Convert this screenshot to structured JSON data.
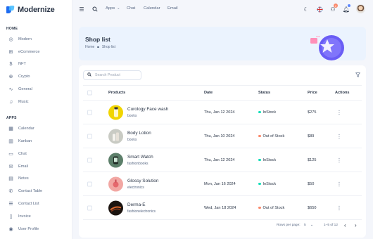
{
  "app": {
    "name": "Modernize"
  },
  "colors": {
    "primary": "#5d87ff",
    "success": "#13deb9",
    "warning": "#fa896b",
    "text": "#2a3547",
    "muted": "#5a6a85"
  },
  "sidebar": {
    "sections": [
      {
        "title": "HOME",
        "items": [
          {
            "label": "Modern",
            "icon": "aperture-icon"
          },
          {
            "label": "eCommerce",
            "icon": "shopping-cart-icon"
          },
          {
            "label": "NFT",
            "icon": "currency-dollar-icon"
          },
          {
            "label": "Crypto",
            "icon": "cpu-icon"
          },
          {
            "label": "General",
            "icon": "activity-icon"
          },
          {
            "label": "Music",
            "icon": "music-icon"
          }
        ]
      },
      {
        "title": "APPS",
        "items": [
          {
            "label": "Calendar",
            "icon": "calendar-icon"
          },
          {
            "label": "Kanban",
            "icon": "layout-kanban-icon"
          },
          {
            "label": "Chat",
            "icon": "message-icon"
          },
          {
            "label": "Email",
            "icon": "mail-icon"
          },
          {
            "label": "Notes",
            "icon": "notes-icon"
          },
          {
            "label": "Contact Table",
            "icon": "phone-icon"
          },
          {
            "label": "Contact List",
            "icon": "list-details-icon"
          },
          {
            "label": "Invoice",
            "icon": "file-text-icon"
          },
          {
            "label": "User Profile",
            "icon": "user-circle-icon"
          }
        ]
      }
    ]
  },
  "topbar": {
    "apps": "Apps",
    "chat": "Chat",
    "calendar": "Calendar",
    "email": "Email",
    "cart_count": "2"
  },
  "banner": {
    "title": "Shop list",
    "breadcrumb_home": "Home",
    "breadcrumb_current": "Shop list"
  },
  "table": {
    "search_placeholder": "Search Product",
    "headers": {
      "products": "Products",
      "date": "Date",
      "status": "Status",
      "price": "Price",
      "actions": "Actions"
    },
    "rows": [
      {
        "name": "Curology Face wash",
        "category": "books",
        "date": "Thu, Jan 12 2024",
        "status": "InStock",
        "status_color": "#13deb9",
        "price": "$275",
        "thumb": "#f1d500"
      },
      {
        "name": "Body Lotion",
        "category": "books",
        "date": "Thu, Jan 10 2024",
        "status": "Out of Stock",
        "status_color": "#fa896b",
        "price": "$89",
        "thumb": "#c9cbc4"
      },
      {
        "name": "Smart Watch",
        "category": "fashionbooks",
        "date": "Thu, Jan 12 2024",
        "status": "InStock",
        "status_color": "#13deb9",
        "price": "$125",
        "thumb": "#5c7f6a"
      },
      {
        "name": "Glossy Solution",
        "category": "electronics",
        "date": "Mon, Jan 16 2024",
        "status": "InStock",
        "status_color": "#13deb9",
        "price": "$50",
        "thumb": "#f2a7a3"
      },
      {
        "name": "Derma-E",
        "category": "fashionelectronics",
        "date": "Wed, Jan 18 2024",
        "status": "Out of Stock",
        "status_color": "#fa896b",
        "price": "$650",
        "thumb": "#1b1410"
      }
    ]
  },
  "pagination": {
    "rows_label": "Rows per page:",
    "rows_value": "5",
    "range": "1–5 of 12"
  }
}
